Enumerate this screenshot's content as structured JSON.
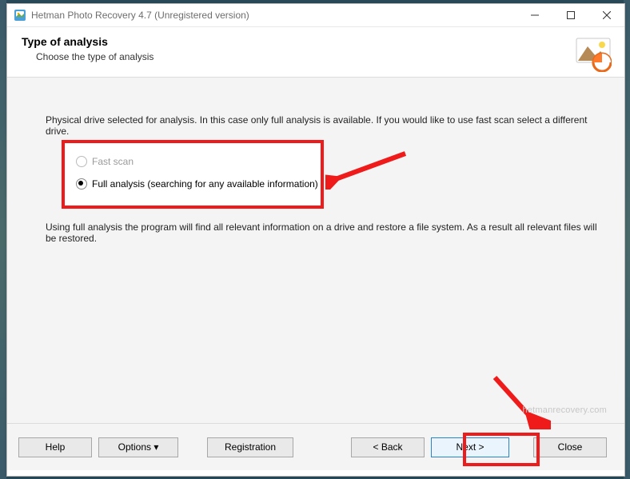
{
  "window": {
    "title": "Hetman Photo Recovery 4.7 (Unregistered version)"
  },
  "header": {
    "title": "Type of analysis",
    "subtitle": "Choose the type of analysis"
  },
  "body": {
    "info_top": "Physical drive selected for analysis. In this case only full analysis is available. If you would like to use fast scan select a different drive.",
    "option_fast": "Fast scan",
    "option_full": "Full analysis (searching for any available information)",
    "info_bottom": "Using full analysis the program will find all relevant information on a drive and restore a file system. As a result all relevant files will be restored."
  },
  "footer": {
    "help": "Help",
    "options": "Options ▾",
    "registration": "Registration",
    "back": "< Back",
    "next": "Next >",
    "close": "Close"
  },
  "watermark": "hetmanrecovery.com"
}
